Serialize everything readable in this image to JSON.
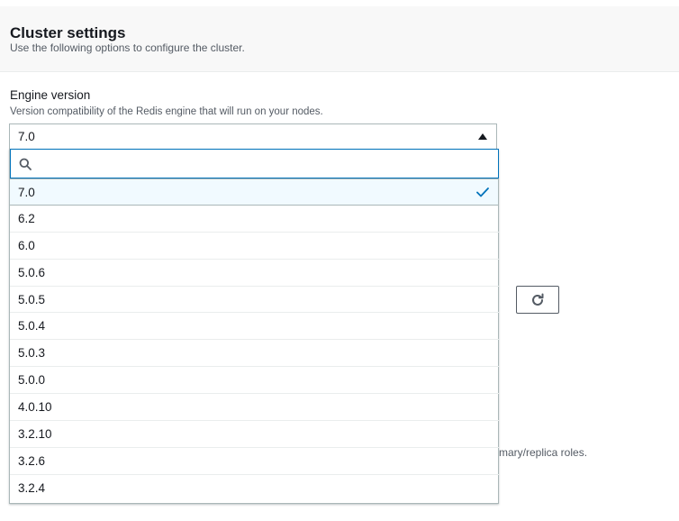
{
  "section": {
    "title": "Cluster settings",
    "description": "Use the following options to configure the cluster."
  },
  "engine_version": {
    "label": "Engine version",
    "description": "Version compatibility of the Redis engine that will run on your nodes.",
    "selected_value": "7.0",
    "search_placeholder": "",
    "options": [
      {
        "label": "7.0",
        "selected": true
      },
      {
        "label": "6.2",
        "selected": false
      },
      {
        "label": "6.0",
        "selected": false
      },
      {
        "label": "5.0.6",
        "selected": false
      },
      {
        "label": "5.0.5",
        "selected": false
      },
      {
        "label": "5.0.4",
        "selected": false
      },
      {
        "label": "5.0.3",
        "selected": false
      },
      {
        "label": "5.0.0",
        "selected": false
      },
      {
        "label": "4.0.10",
        "selected": false
      },
      {
        "label": "3.2.10",
        "selected": false
      },
      {
        "label": "3.2.6",
        "selected": false
      },
      {
        "label": "3.2.4",
        "selected": false
      }
    ]
  },
  "background": {
    "partial_text": "mary/replica roles."
  },
  "icons": {
    "caret": "caret-up-icon",
    "search": "search-icon",
    "check": "check-icon",
    "refresh": "refresh-icon"
  },
  "colors": {
    "accent": "#0073bb",
    "selected_bg": "#f1faff",
    "header_bg": "#f8f8f8"
  }
}
